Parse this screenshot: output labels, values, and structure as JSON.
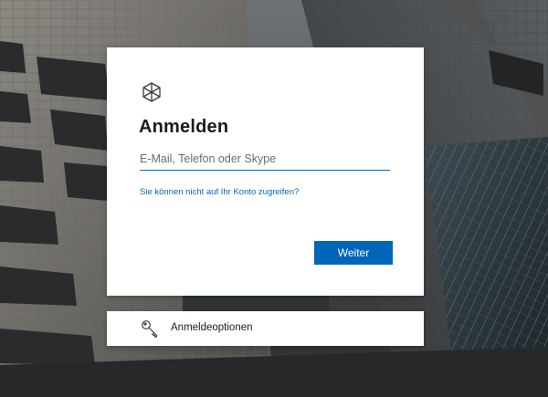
{
  "background": {
    "description_icon": "building-photo",
    "tone": "#3a3e42"
  },
  "signin": {
    "logo_icon": "microsoft-cube-icon",
    "title": "Anmelden",
    "email_placeholder": "E-Mail, Telefon oder Skype",
    "email_value": "",
    "cant_access_link": "Sie können nicht auf Ihr Konto zugreifen?",
    "next_button": "Weiter"
  },
  "options": {
    "icon": "key-icon",
    "label": "Anmeldeoptionen"
  },
  "colors": {
    "accent": "#0067b8",
    "card": "#ffffff",
    "text": "#1b1b1b"
  }
}
